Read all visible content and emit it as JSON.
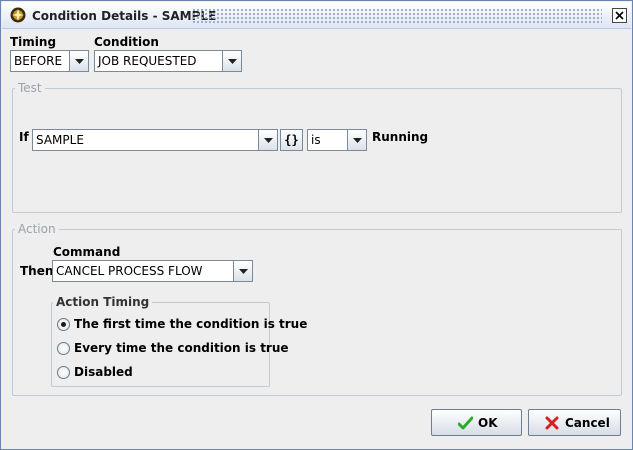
{
  "window": {
    "title": "Condition Details - SAMPLE"
  },
  "timing": {
    "label": "Timing",
    "value": "BEFORE"
  },
  "condition": {
    "label": "Condition",
    "value": "JOB REQUESTED"
  },
  "test": {
    "group_title": "Test",
    "if_label": "If",
    "subject_value": "SAMPLE",
    "braces_label": "{}",
    "operator_value": "is",
    "state_label": "Running"
  },
  "action": {
    "group_title": "Action",
    "then_label": "Then",
    "command_label": "Command",
    "command_value": "CANCEL PROCESS FLOW",
    "timing": {
      "title": "Action Timing",
      "options": [
        {
          "label": "The first time the condition is true",
          "selected": true
        },
        {
          "label": "Every time the condition is true",
          "selected": false
        },
        {
          "label": "Disabled",
          "selected": false
        }
      ]
    }
  },
  "buttons": {
    "ok_label": "OK",
    "cancel_label": "Cancel"
  },
  "colors": {
    "ok_check": "#2fa82f",
    "cancel_x": "#d42020"
  }
}
